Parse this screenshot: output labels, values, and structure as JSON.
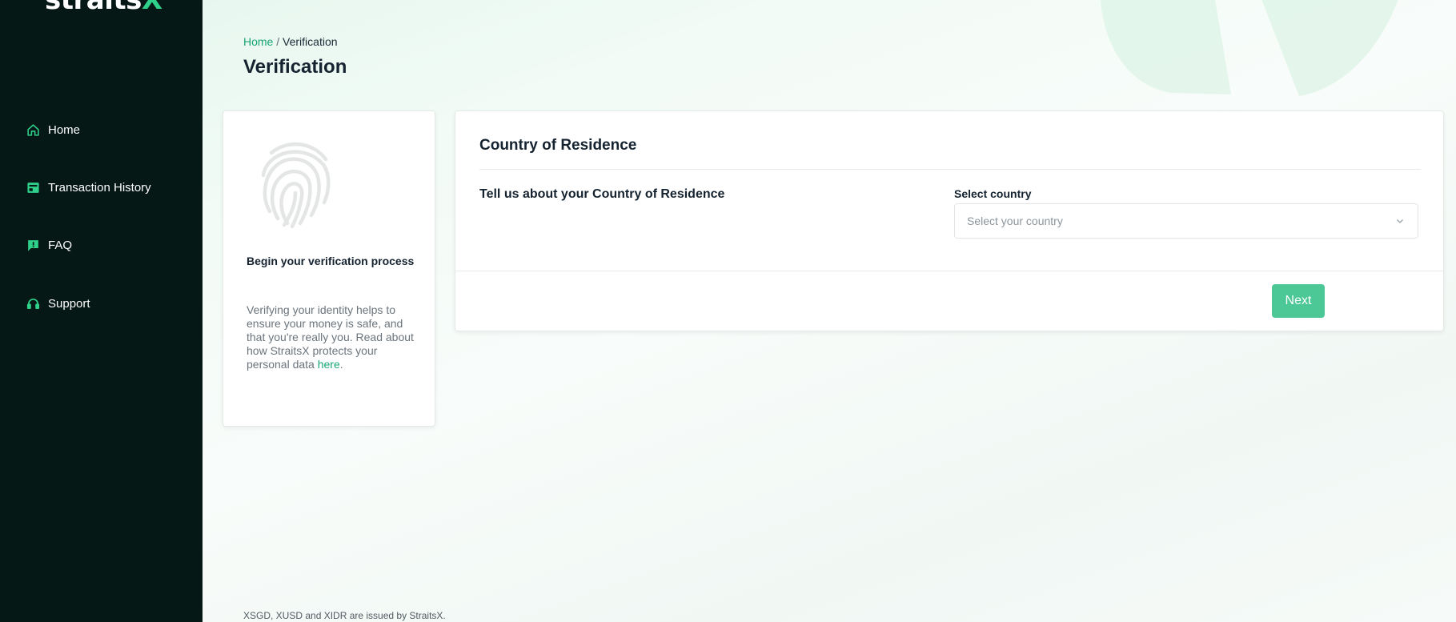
{
  "brand": {
    "name_main": "straits",
    "name_accent": "X",
    "accent_color": "#2fd08a",
    "sidebar_bg": "#051816"
  },
  "sidebar": {
    "items": [
      {
        "label": "Home",
        "icon": "home-icon"
      },
      {
        "label": "Transaction History",
        "icon": "transaction-history-icon"
      },
      {
        "label": "FAQ",
        "icon": "faq-icon"
      },
      {
        "label": "Support",
        "icon": "headset-icon"
      }
    ]
  },
  "breadcrumb": {
    "home": "Home",
    "separator": "/",
    "current": "Verification"
  },
  "page": {
    "title": "Verification"
  },
  "info_card": {
    "icon": "fingerprint-icon",
    "title": "Begin your verification process",
    "text": "Verifying your identity helps to ensure your money is safe, and that you're really you. Read about how StraitsX protects your personal data",
    "link_text": "here",
    "link_suffix": "."
  },
  "form": {
    "title": "Country of Residence",
    "question": "Tell us about your Country of Residence",
    "field_label": "Select country",
    "select_placeholder": "Select your country",
    "next_label": "Next",
    "next_color": "#4cc896"
  },
  "footer": {
    "text": "XSGD, XUSD and XIDR are issued by StraitsX."
  }
}
